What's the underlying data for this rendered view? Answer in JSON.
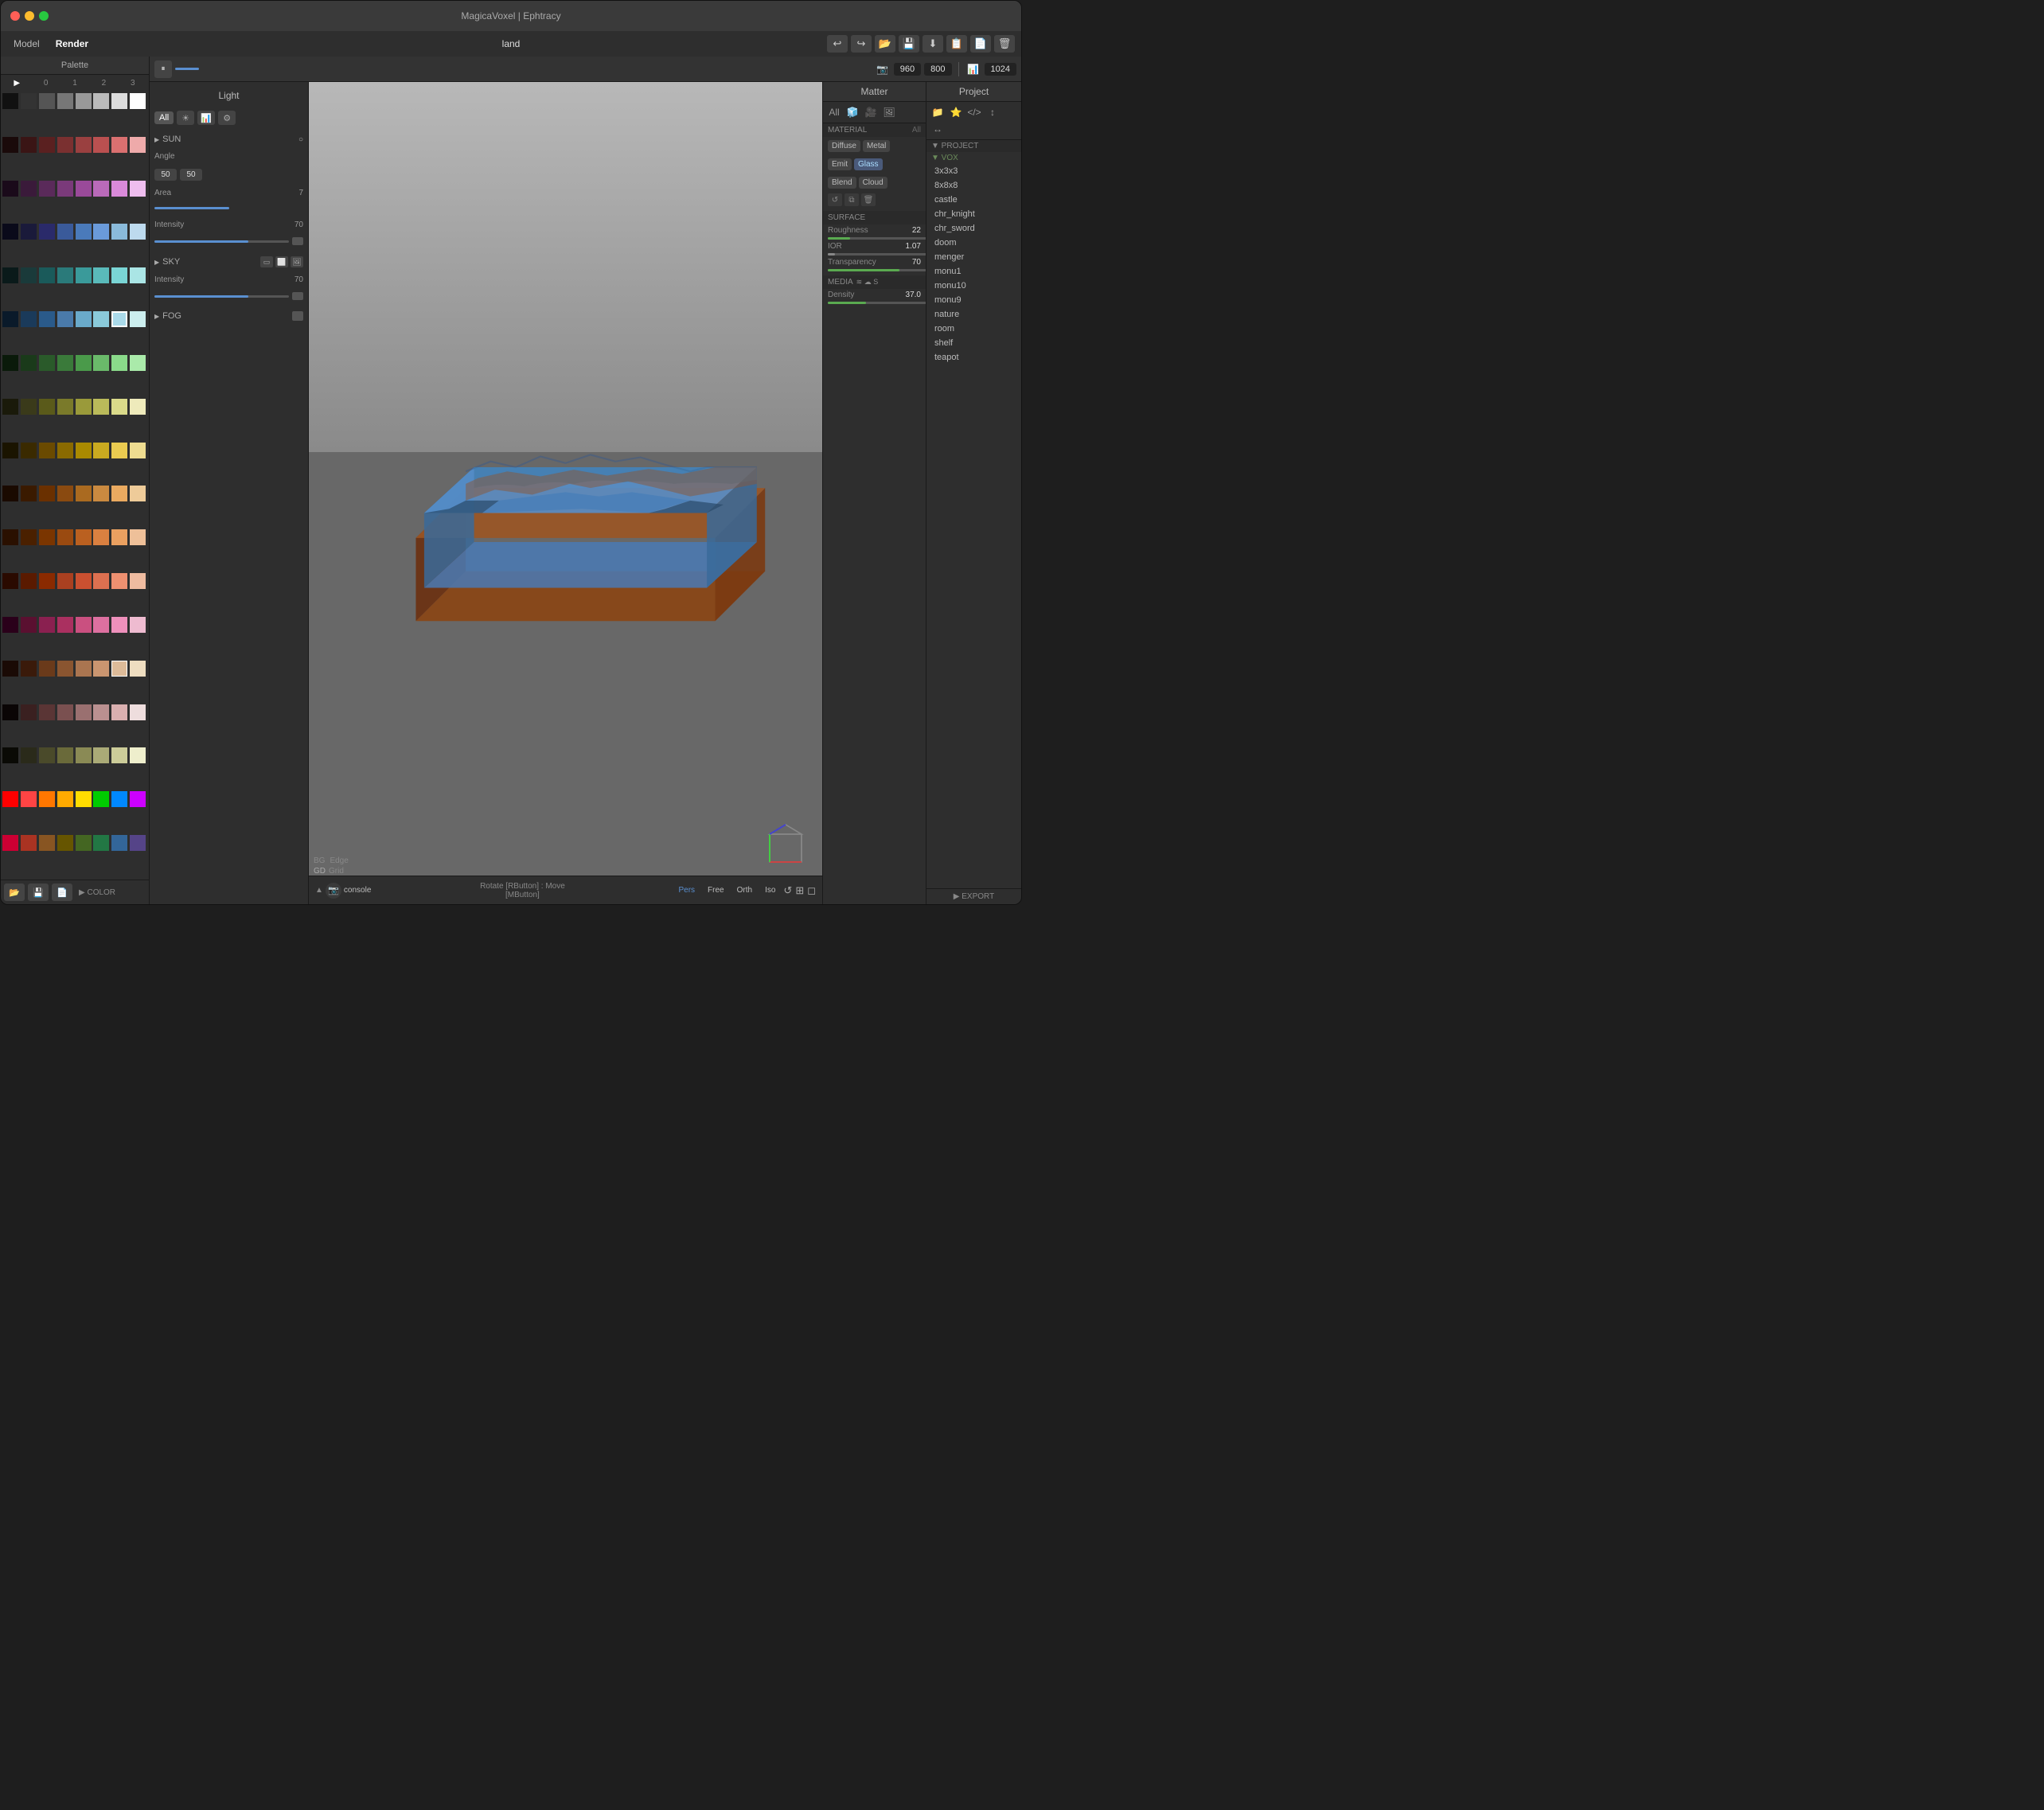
{
  "app": {
    "title": "MagicaVoxel | Ephtracy",
    "current_file": "land"
  },
  "traffic_lights": {
    "red": "#ff5f57",
    "yellow": "#febc2e",
    "green": "#28c840"
  },
  "menubar": {
    "model_label": "Model",
    "render_label": "Render",
    "filename": "land",
    "toolbar_buttons": [
      "↩",
      "↪",
      "📁",
      "💾",
      "⬇",
      "📋",
      "📄",
      "🗑"
    ]
  },
  "palette": {
    "header": "Palette",
    "tabs": [
      "▶",
      "0",
      "1",
      "2",
      "3"
    ],
    "color_label": "▶ COLOR",
    "bottom_buttons": [
      "📁",
      "💾",
      "📄"
    ]
  },
  "light_panel": {
    "header": "Light",
    "filter_buttons": [
      "All",
      "☀",
      "📊",
      "⚙"
    ],
    "sun_section": "SUN",
    "sun_circle": "○",
    "angle_label": "Angle",
    "angle_val1": "50",
    "angle_val2": "50",
    "area_label": "Area",
    "area_val": "7",
    "intensity_label": "Intensity",
    "intensity_val": "70",
    "sky_section": "SKY",
    "sky_intensity_label": "Intensity",
    "sky_intensity_val": "70",
    "fog_section": "FOG"
  },
  "render_toolbar": {
    "pause_btn": "⏸",
    "cam_icon": "📷",
    "width": "960",
    "height": "800",
    "chart_icon": "📊",
    "samples": "1024"
  },
  "viewport": {
    "bottom": {
      "bg_label": "BG",
      "edge_label": "Edge",
      "gd_label": "GD",
      "grid_label": "Grid",
      "console_text": "console",
      "status_text": "Rotate [RButton] : Move [MButton]",
      "pers": "Pers",
      "free": "Free",
      "orth": "Orth",
      "iso": "Iso",
      "nav_icons": [
        "↺",
        "⊞",
        "◻"
      ]
    }
  },
  "matter_panel": {
    "header": "Matter",
    "filter_buttons": [
      "All",
      "🧊",
      "🎥",
      "🖼"
    ],
    "material_section": "MATERIAL",
    "all_label": "All",
    "buttons": {
      "diffuse": "Diffuse",
      "metal": "Metal",
      "emit": "Emit",
      "glass": "Glass",
      "blend": "Blend",
      "cloud": "Cloud"
    },
    "surface_section": "SURFACE",
    "roughness_label": "Roughness",
    "roughness_val": "22",
    "ior_label": "IOR",
    "ior_val": "1.07",
    "transparency_label": "Transparency",
    "transparency_val": "70",
    "media_section": "MEDIA",
    "density_label": "Density",
    "density_val": "37.0"
  },
  "project_panel": {
    "header": "Project",
    "filter_buttons": [
      "📁",
      "⭐",
      "<>",
      "↕",
      "↔"
    ],
    "project_label": "▼ PROJECT",
    "vox_label": "▼ VOX",
    "items": [
      "3x3x3",
      "8x8x8",
      "castle",
      "chr_knight",
      "chr_sword",
      "doom",
      "menger",
      "monu1",
      "monu10",
      "monu9",
      "nature",
      "room",
      "shelf",
      "teapot"
    ],
    "export_label": "▶ EXPORT"
  },
  "colors": {
    "accent_blue": "#5a8fd0",
    "accent_green": "#5aaa50",
    "surface_roughness_color": "#5aaa50",
    "ior_color": "#888",
    "transparency_color": "#5aaa50"
  }
}
